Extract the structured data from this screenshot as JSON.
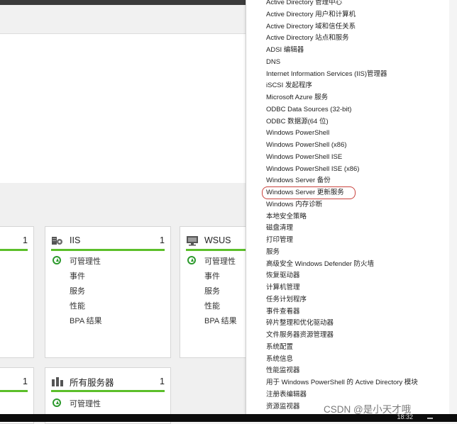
{
  "tiles": [
    {
      "title": "",
      "count": "1",
      "rows": []
    },
    {
      "title": "IIS",
      "count": "1",
      "rows": [
        "可管理性",
        "事件",
        "服务",
        "性能",
        "BPA 结果"
      ]
    },
    {
      "title": "WSUS",
      "count": "",
      "rows": [
        "可管理性",
        "事件",
        "服务",
        "性能",
        "BPA 结果"
      ]
    },
    {
      "title": "",
      "count": "1",
      "rows": []
    },
    {
      "title": "所有服务器",
      "count": "1",
      "rows": [
        "可管理性"
      ]
    }
  ],
  "tools_menu": {
    "items": [
      "Active Directory 管理中心",
      "Active Directory 用户和计算机",
      "Active Directory 域和信任关系",
      "Active Directory 站点和服务",
      "ADSI 编辑器",
      "DNS",
      "Internet Information Services (IIS)管理器",
      "iSCSI 发起程序",
      "Microsoft Azure 服务",
      "ODBC Data Sources (32-bit)",
      "ODBC 数据源(64 位)",
      "Windows PowerShell",
      "Windows PowerShell (x86)",
      "Windows PowerShell ISE",
      "Windows PowerShell ISE (x86)",
      "Windows Server 备份",
      "Windows Server 更新服务",
      "Windows 内存诊断",
      "本地安全策略",
      "磁盘清理",
      "打印管理",
      "服务",
      "高级安全 Windows Defender 防火墙",
      "恢复驱动器",
      "计算机管理",
      "任务计划程序",
      "事件查看器",
      "碎片整理和优化驱动器",
      "文件服务器资源管理器",
      "系统配置",
      "系统信息",
      "性能监视器",
      "用于 Windows PowerShell 的 Active Directory 模块",
      "注册表编辑器",
      "资源监视器"
    ],
    "highlighted_index": 16,
    "highlight_color": "#c9423d"
  },
  "status_color": "#5cbf2a",
  "taskbar": {
    "clock": "18:32"
  },
  "watermark": "CSDN @是小天才哦"
}
